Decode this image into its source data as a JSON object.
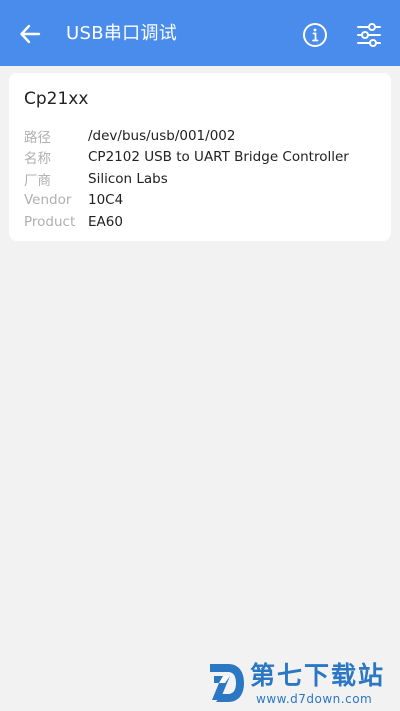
{
  "appbar": {
    "title": "USB串口调试",
    "back_icon": "arrow-left-icon",
    "info_icon": "info-icon",
    "settings_icon": "sliders-icon"
  },
  "device": {
    "name": "Cp21xx",
    "fields": [
      {
        "label": "路径",
        "value": "/dev/bus/usb/001/002"
      },
      {
        "label": "名称",
        "value": "CP2102 USB to UART Bridge Controller"
      },
      {
        "label": "厂商",
        "value": "Silicon Labs"
      },
      {
        "label": "Vendor",
        "value": "10C4"
      },
      {
        "label": "Product",
        "value": "EA60"
      }
    ]
  },
  "watermark": {
    "title": "第七下载站",
    "url": "www.d7down.com"
  },
  "colors": {
    "appbar": "#4a8cec",
    "background": "#f2f2f2",
    "watermark": "#2b77c4"
  }
}
